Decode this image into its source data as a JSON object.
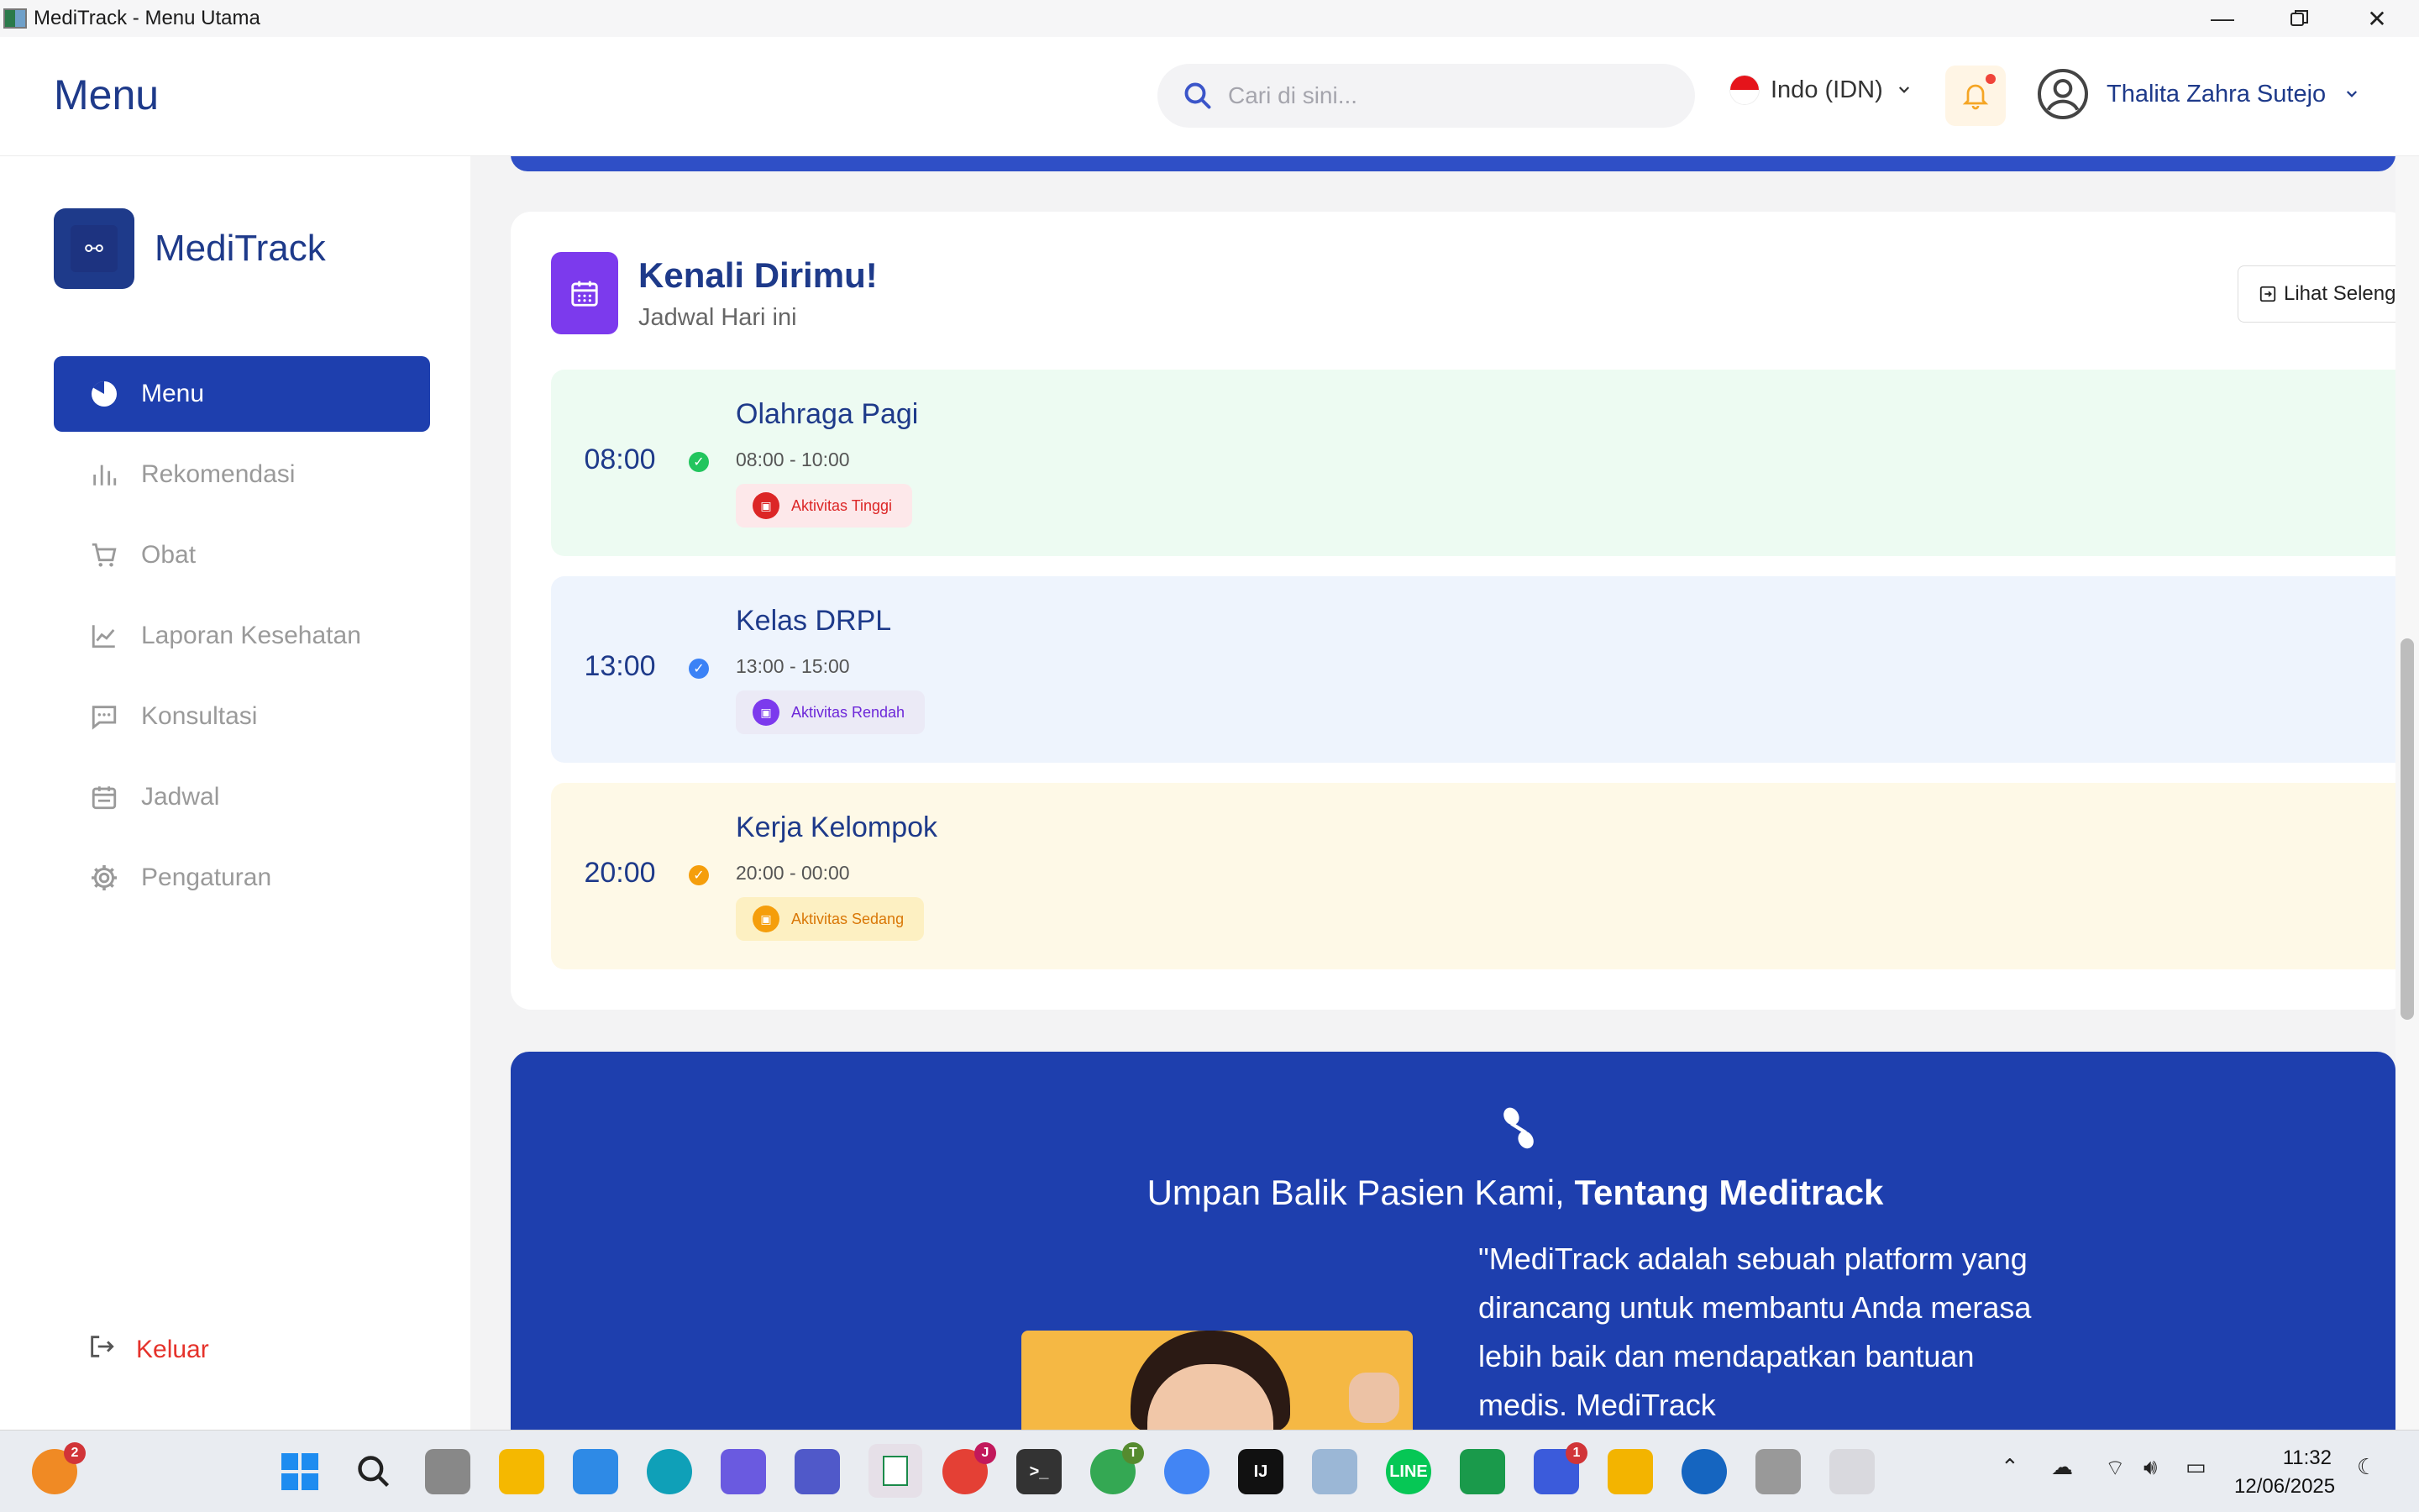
{
  "window": {
    "title": "MediTrack - Menu Utama"
  },
  "header": {
    "page_title": "Menu",
    "search_placeholder": "Cari di sini...",
    "language": "Indo (IDN)",
    "user_name": "Thalita Zahra Sutejo"
  },
  "sidebar": {
    "brand": "MediTrack",
    "items": [
      {
        "label": "Menu",
        "icon": "pie-chart-icon",
        "active": true
      },
      {
        "label": "Rekomendasi",
        "icon": "bar-chart-icon"
      },
      {
        "label": "Obat",
        "icon": "cart-icon"
      },
      {
        "label": "Laporan Kesehatan",
        "icon": "line-chart-icon"
      },
      {
        "label": "Konsultasi",
        "icon": "chat-icon"
      },
      {
        "label": "Jadwal",
        "icon": "calendar-icon"
      },
      {
        "label": "Pengaturan",
        "icon": "gear-icon"
      }
    ],
    "logout": "Keluar"
  },
  "schedule_card": {
    "title": "Kenali Dirimu!",
    "subtitle": "Jadwal Hari ini",
    "see_more": "Lihat Seleng",
    "items": [
      {
        "time": "08:00",
        "name": "Olahraga Pagi",
        "range": "08:00 - 10:00",
        "badge": "Aktivitas Tinggi",
        "bg": "#edfbf2",
        "dot": "#22c55e",
        "badge_bg": "#fde8ea",
        "badge_fg": "#dc2626",
        "badge_icon": "#dc2626"
      },
      {
        "time": "13:00",
        "name": "Kelas DRPL",
        "range": "13:00 - 15:00",
        "badge": "Aktivitas Rendah",
        "bg": "#eef4fd",
        "dot": "#3b82f6",
        "badge_bg": "#ebeaf6",
        "badge_fg": "#6d28d9",
        "badge_icon": "#7c3aed"
      },
      {
        "time": "20:00",
        "name": "Kerja Kelompok",
        "range": "20:00 - 00:00",
        "badge": "Aktivitas Sedang",
        "bg": "#fef9e7",
        "dot": "#f59e0b",
        "badge_bg": "#fdf0c2",
        "badge_fg": "#d97706",
        "badge_icon": "#f59e0b"
      }
    ]
  },
  "feedback": {
    "title_regular": "Umpan Balik Pasien Kami, ",
    "title_bold": "Tentang Meditrack",
    "quote": "\"MediTrack adalah sebuah platform yang dirancang untuk membantu Anda merasa lebih baik dan mendapatkan bantuan medis. MediTrack"
  },
  "taskbar": {
    "time": "11:32",
    "date": "12/06/2025",
    "badges": {
      "weather": "2",
      "chrome_j": "J",
      "chrome_t": "T",
      "notif": "1"
    }
  },
  "colors": {
    "primary": "#1e3a8a",
    "active_nav": "#1e3fae",
    "purple": "#7c3aed",
    "logout": "#e5322b"
  }
}
